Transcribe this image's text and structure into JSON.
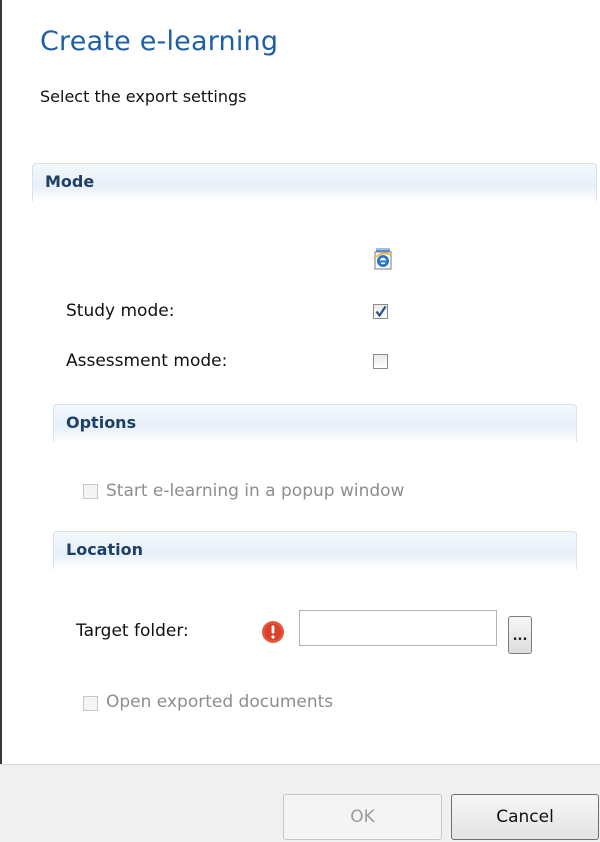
{
  "dialog": {
    "title": "Create e-learning",
    "subtitle": "Select the export settings"
  },
  "mode": {
    "header": "Mode",
    "icon": "internet-explorer-icon",
    "study_label": "Study mode:",
    "study_checked": true,
    "assessment_label": "Assessment mode:",
    "assessment_checked": false
  },
  "options": {
    "header": "Options",
    "popup_label": "Start e-learning in a popup window",
    "popup_checked": false,
    "popup_enabled": false
  },
  "location": {
    "header": "Location",
    "target_label": "Target folder:",
    "target_value": "",
    "validation_icon": "error-icon",
    "browse_label": "...",
    "open_docs_label": "Open exported documents",
    "open_docs_checked": false,
    "open_docs_enabled": false
  },
  "footer": {
    "ok_label": "OK",
    "ok_enabled": false,
    "cancel_label": "Cancel"
  },
  "colors": {
    "title": "#1f5fa6",
    "section_header_text": "#1e3f66",
    "error": "#d9412b"
  }
}
